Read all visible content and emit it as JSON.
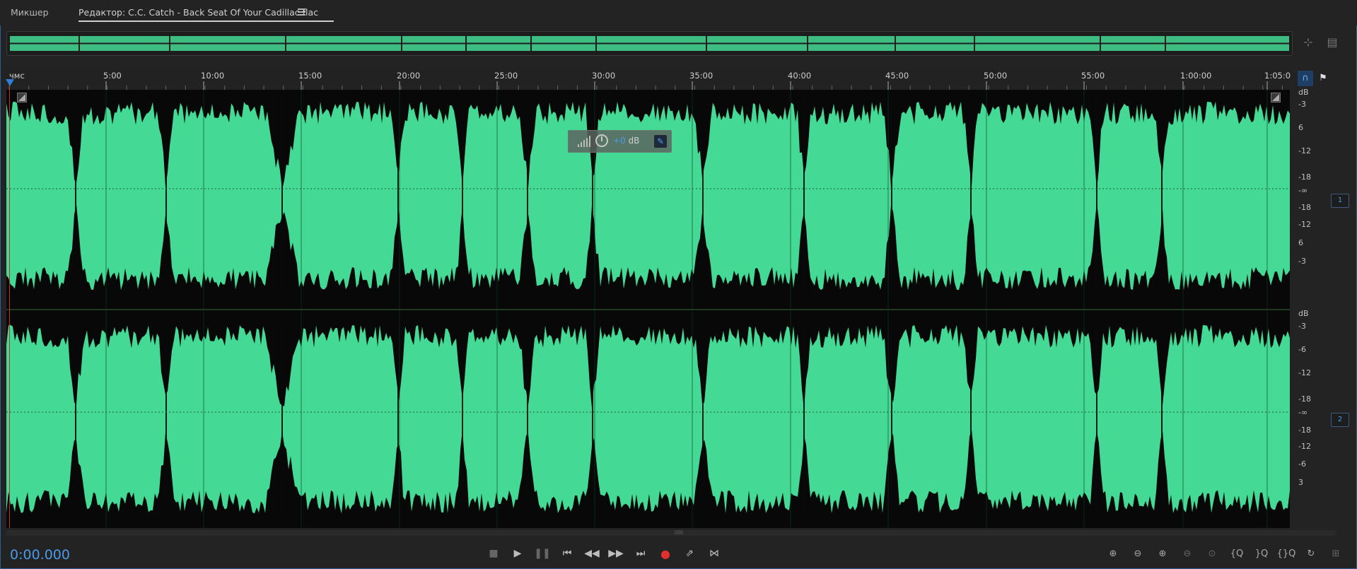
{
  "tabs": {
    "mixer": "Микшер",
    "editor": "Редактор: C.C. Catch - Back Seat Of Your Cadillac.flac"
  },
  "ruler": {
    "unit_label": "чмс",
    "ticks": [
      "5:00",
      "10:00",
      "15:00",
      "20:00",
      "25:00",
      "30:00",
      "35:00",
      "40:00",
      "45:00",
      "50:00",
      "55:00",
      "1:00:00",
      "1:05:0"
    ]
  },
  "hud": {
    "gain_value": "+0",
    "gain_unit": "dB"
  },
  "db_scale": {
    "unit": "dB",
    "labels": [
      "-3",
      "6",
      "-12",
      "-18",
      "-∞",
      "-18",
      "-12",
      "6",
      "-3"
    ],
    "labels_ch2": [
      "-3",
      "-6",
      "-12",
      "-18",
      "-∞",
      "-18",
      "-12",
      "-6",
      "3"
    ]
  },
  "channels": [
    "1",
    "2"
  ],
  "transport": {
    "time": "0:00.000"
  },
  "icons": {
    "stop": "stop-icon",
    "play": "play-icon",
    "pause": "pause-icon",
    "prev": "skip-to-start-icon",
    "rewind": "rewind-icon",
    "forward": "fast-forward-icon",
    "next": "skip-to-end-icon",
    "record": "record-icon",
    "loop": "loop-playback-icon",
    "skip_selection": "skip-selection-icon"
  },
  "colors": {
    "waveform": "#44d995",
    "accent": "#4a9ae8",
    "record": "#e03030",
    "background": "#080808"
  }
}
